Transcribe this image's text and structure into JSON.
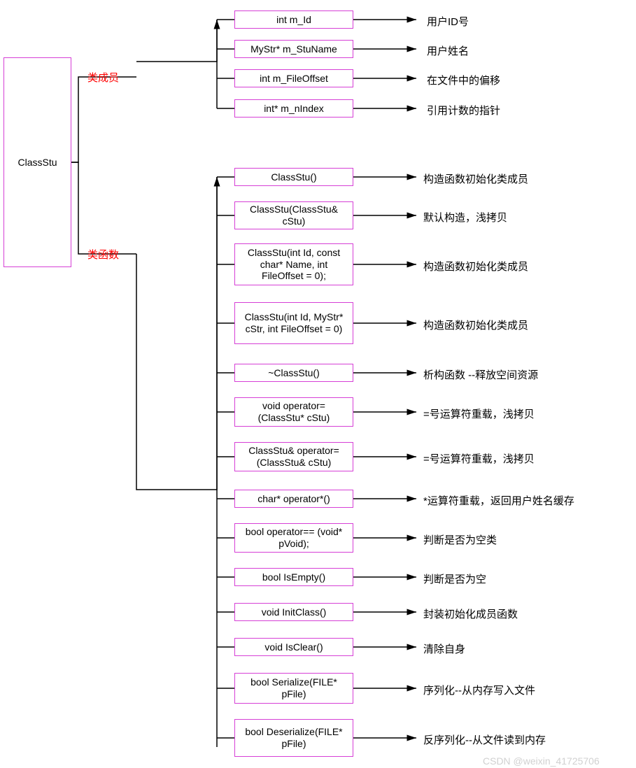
{
  "root": {
    "title": "ClassStu"
  },
  "sections": {
    "members_label": "类成员",
    "functions_label": "类函数"
  },
  "members": [
    {
      "name": "int m_Id",
      "desc": "用户ID号"
    },
    {
      "name": "MyStr* m_StuName",
      "desc": "用户姓名"
    },
    {
      "name": "int m_FileOffset",
      "desc": "在文件中的偏移"
    },
    {
      "name": "int* m_nIndex",
      "desc": "引用计数的指针"
    }
  ],
  "functions": [
    {
      "name": "ClassStu()",
      "desc": "构造函数初始化类成员"
    },
    {
      "name": "ClassStu(ClassStu& cStu)",
      "desc": "默认构造，浅拷贝"
    },
    {
      "name": "ClassStu(int Id, const char* Name, int FileOffset = 0);",
      "desc": "构造函数初始化类成员"
    },
    {
      "name": "ClassStu(int Id, MyStr* cStr, int FileOffset = 0)",
      "desc": "构造函数初始化类成员"
    },
    {
      "name": "~ClassStu()",
      "desc": "析构函数 --释放空间资源"
    },
    {
      "name": "void operator= (ClassStu* cStu)",
      "desc": "=号运算符重载，浅拷贝"
    },
    {
      "name": "ClassStu& operator= (ClassStu& cStu)",
      "desc": "=号运算符重载，浅拷贝"
    },
    {
      "name": "char* operator*()",
      "desc": "*运算符重载，返回用户姓名缓存"
    },
    {
      "name": "bool operator== (void* pVoid);",
      "desc": "判断是否为空类"
    },
    {
      "name": "bool IsEmpty()",
      "desc": "判断是否为空"
    },
    {
      "name": "void InitClass()",
      "desc": "封装初始化成员函数"
    },
    {
      "name": "void IsClear()",
      "desc": "清除自身"
    },
    {
      "name": "bool Serialize(FILE* pFile)",
      "desc": "序列化--从内存写入文件"
    },
    {
      "name": "bool Deserialize(FILE* pFile)",
      "desc": "反序列化--从文件读到内存"
    }
  ],
  "watermark": "CSDN @weixin_41725706"
}
